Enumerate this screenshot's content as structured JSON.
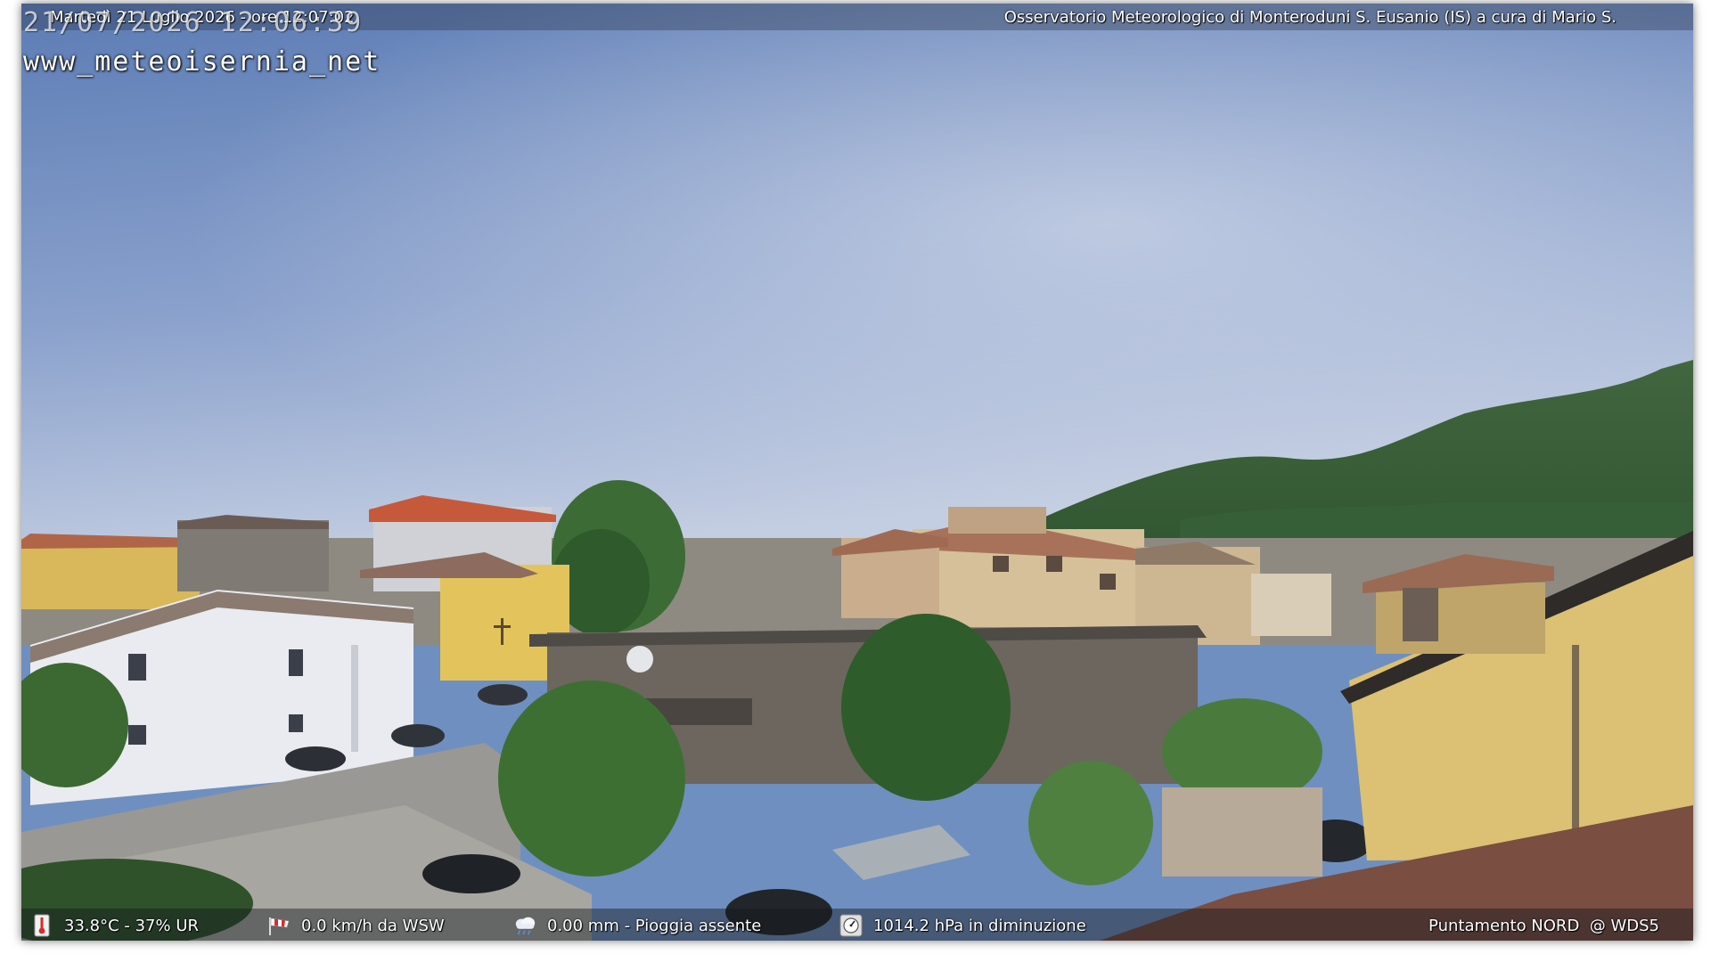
{
  "overlay": {
    "header_left": "Martedì 21 Luglio 2026 - ore 12:07:02",
    "header_right": "Osservatorio Meteorologico di Monteroduni S. Eusanio (IS) a cura di Mario S.",
    "camera_timestamp": "21/07/2026 12:06:39",
    "site_url": "www_meteoisernia_net"
  },
  "stats": {
    "temperature": {
      "icon": "thermometer-icon",
      "text": "33.8°C - 37% UR"
    },
    "wind": {
      "icon": "windsock-icon",
      "text": "0.0 km/h da WSW"
    },
    "rain": {
      "icon": "rain-cloud-icon",
      "text": "0.00 mm - Pioggia assente"
    },
    "pressure": {
      "icon": "barometer-icon",
      "text": "1014.2 hPa in diminuzione"
    },
    "pointing": {
      "text": "Puntamento NORD  @ WDS5"
    }
  },
  "colors": {
    "sky_top": "#5f7fb7",
    "sky_bottom": "#c5cfe3",
    "mountain": "#3f6a3a",
    "roof": "#b5664a",
    "wall_yellow": "#e0c060"
  }
}
